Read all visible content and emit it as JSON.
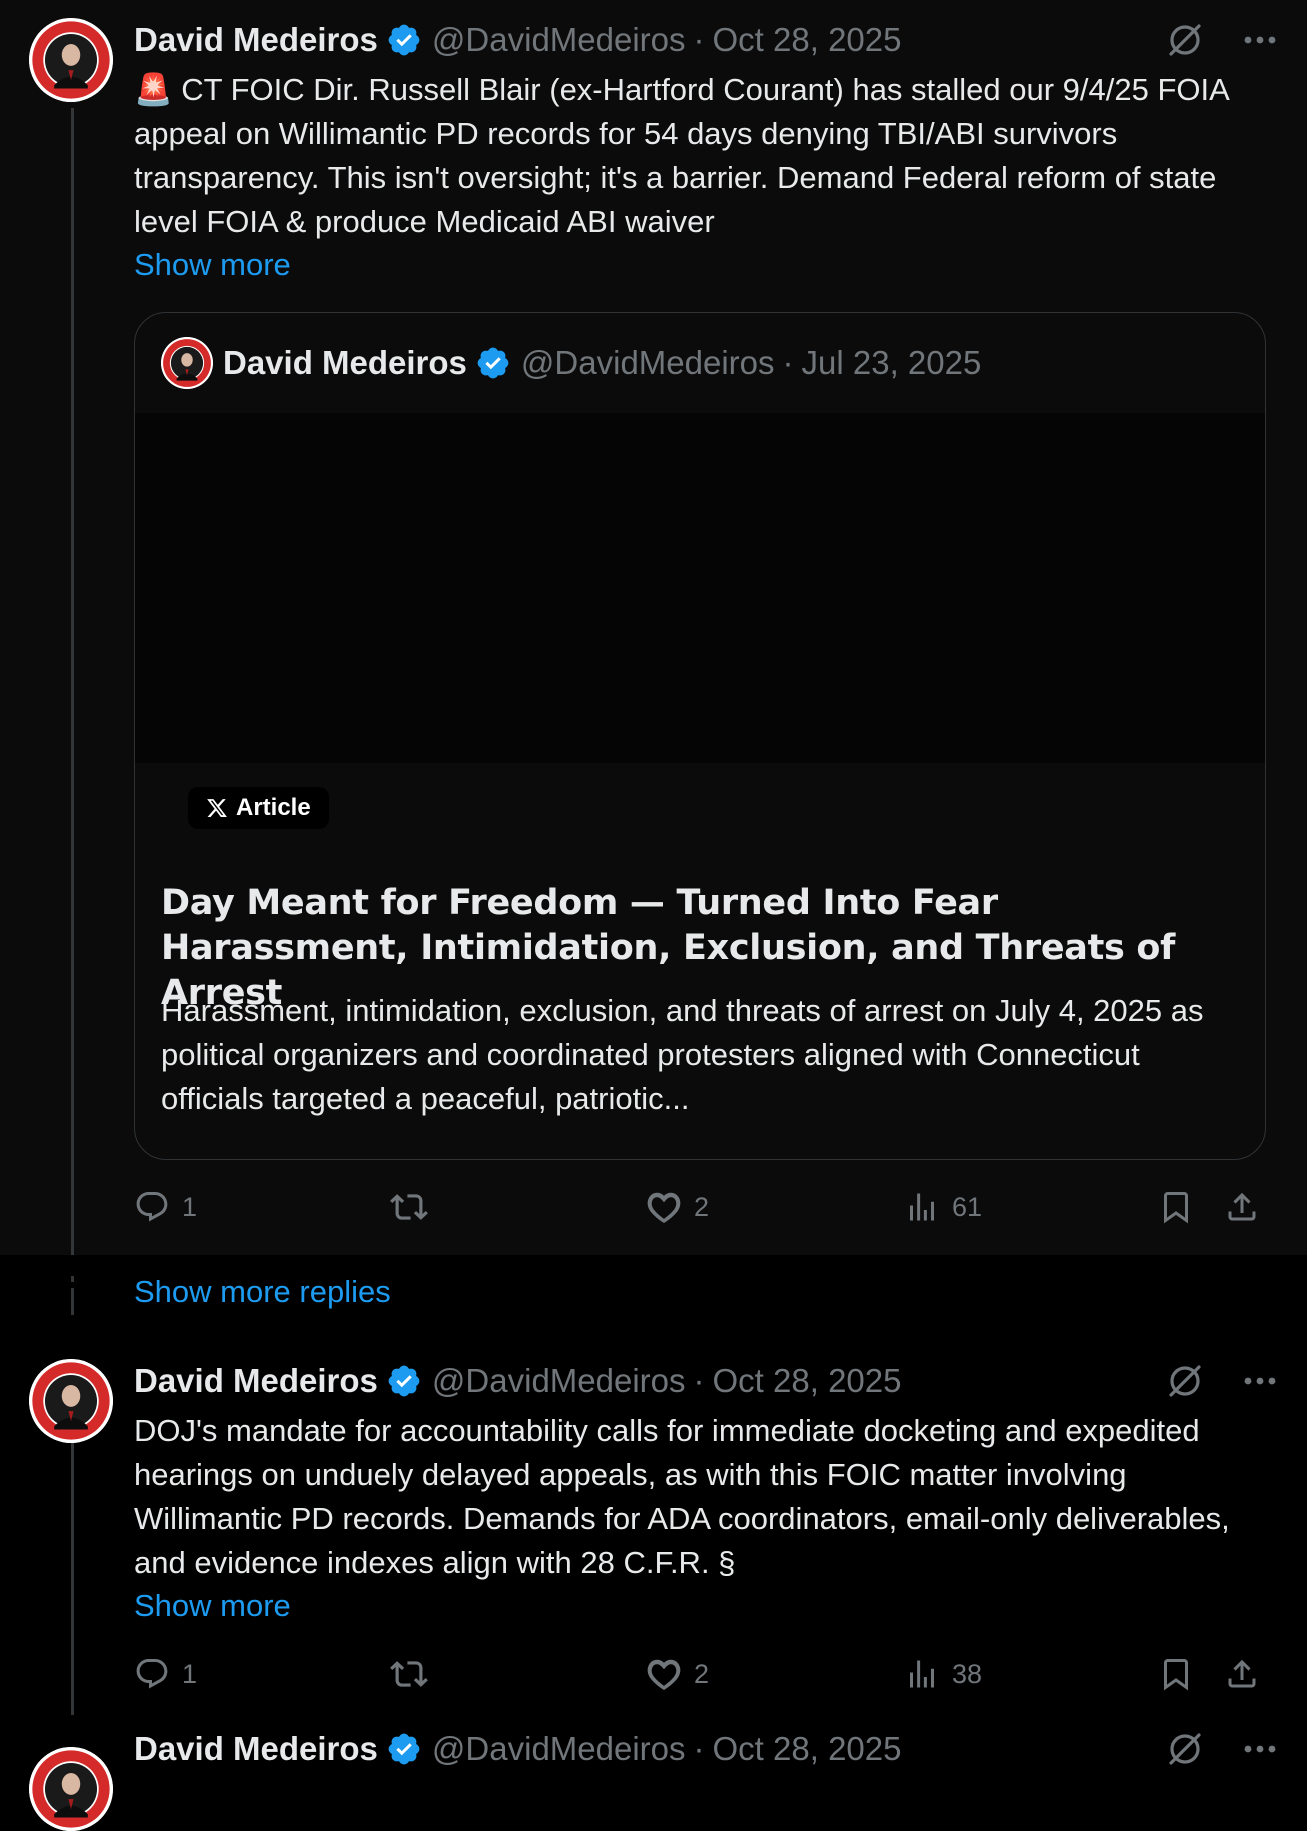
{
  "tweets": [
    {
      "author": "David Medeiros",
      "handle": "@DavidMedeiros",
      "separator": "·",
      "date": "Oct 28, 2025",
      "text": "🚨 CT FOIC Dir. Russell Blair (ex-Hartford Courant) has stalled our 9/4/25 FOIA appeal on Willimantic PD records for 54 days denying TBI/ABI survivors transparency. This isn't oversight; it's a barrier. Demand Federal reform of state level FOIA & produce Medicaid ABI waiver",
      "show_more": "Show more",
      "quote": {
        "author": "David Medeiros",
        "handle": "@DavidMedeiros",
        "separator": "·",
        "date": "Jul 23, 2025",
        "badge": "Article",
        "title": "Day Meant for Freedom — Turned Into Fear Harassment, Intimidation, Exclusion, and Threats of Arrest",
        "description": "Harassment, intimidation, exclusion, and threats of arrest on July 4, 2025 as political organizers and coordinated protesters aligned with Connecticut officials targeted a peaceful, patriotic..."
      },
      "replies": "1",
      "reposts": "",
      "likes": "2",
      "views": "61"
    },
    {
      "author": "David Medeiros",
      "handle": "@DavidMedeiros",
      "separator": "·",
      "date": "Oct 28, 2025",
      "text": "DOJ's mandate for accountability calls for immediate docketing and expedited hearings on unduely delayed appeals, as with this FOIC matter involving Willimantic PD records. Demands for ADA coordinators, email-only deliverables, and evidence indexes align with 28 C.F.R. §",
      "show_more": "Show more",
      "replies": "1",
      "reposts": "",
      "likes": "2",
      "views": "38"
    },
    {
      "author": "David Medeiros",
      "handle": "@DavidMedeiros",
      "separator": "·",
      "date": "Oct 28, 2025"
    }
  ],
  "show_more_replies": "Show more replies",
  "colors": {
    "background": "#000000",
    "highlight_background": "#0b0b0b",
    "text": "#e7e9ea",
    "secondary": "#71767b",
    "link": "#1d9bf0",
    "verified": "#1d9bf0",
    "border": "#2f3336"
  },
  "icons": [
    "verified-badge-icon",
    "grok-icon",
    "more-icon",
    "reply-icon",
    "repost-icon",
    "like-icon",
    "views-icon",
    "bookmark-icon",
    "share-icon",
    "x-logo-icon",
    "siren-emoji"
  ]
}
